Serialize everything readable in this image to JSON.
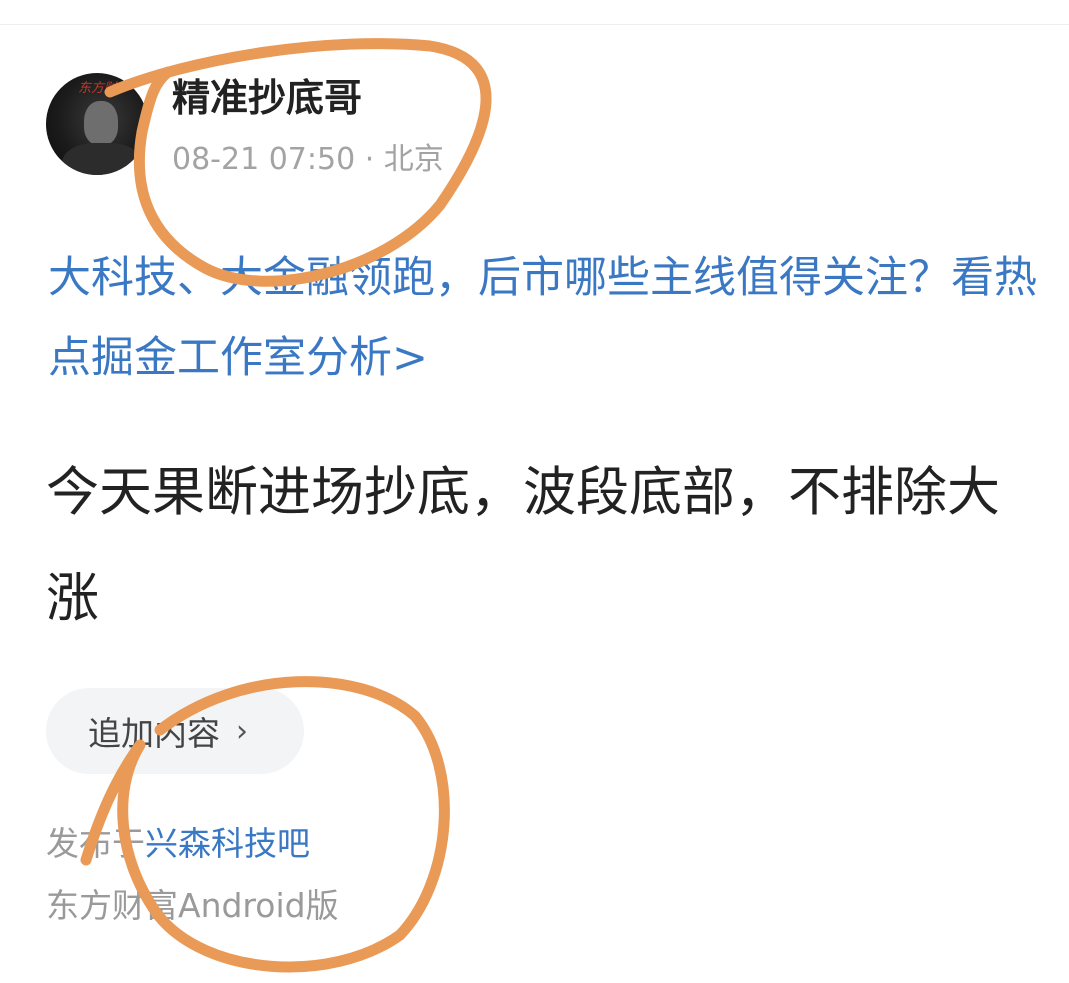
{
  "author": {
    "name": "精准抄底哥",
    "avatar_text": "东方财"
  },
  "post": {
    "meta": "08-21 07:50 · 北京",
    "promo_link": "大科技、大金融领跑，后市哪些主线值得关注？看热点掘金工作室分析>",
    "title": "今天果断进场抄底，波段底部，不排除大涨",
    "add_content_label": "追加内容",
    "published_prefix": "发布于",
    "forum_name": "兴森科技吧",
    "client": "东方财富Android版"
  },
  "icons": {
    "add_content_chevron": "chevron-right-icon"
  },
  "colors": {
    "link": "#3a78c4",
    "title": "#222222",
    "muted": "#9a9a9a",
    "annotation": "#e99a57"
  }
}
